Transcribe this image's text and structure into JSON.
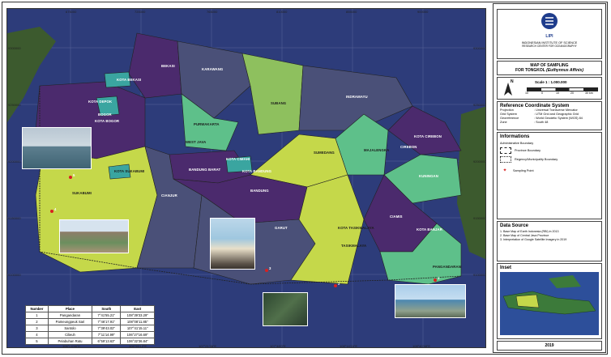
{
  "map": {
    "top_ticks": [
      "675000",
      "720000",
      "765000",
      "810000",
      "855000",
      "900000"
    ],
    "bottom_ticks": [
      "106°24'46\"E",
      "106°55'12\"E",
      "107°21'36\"E",
      "107°48'0\"E",
      "108°14'24\"E",
      "108°40'48\"E"
    ],
    "left_ticks": [
      "9300000",
      "9250000",
      "9200000",
      "9150000",
      "9100000"
    ],
    "right_ticks": [
      "9300000",
      "9250000",
      "9200000",
      "9150000",
      "9100000"
    ],
    "regions": [
      "BEKASI",
      "KARAWANG",
      "KOTA BEKASI",
      "KOTA DEPOK",
      "BOGOR",
      "KOTA BOGOR",
      "SUBANG",
      "PURWAKARTA",
      "INDRAMAYU",
      "WEST JAVA",
      "BANDUNG BARAT",
      "KOTA CIMAHI",
      "KOTA BANDUNG",
      "SUMEDANG",
      "MAJALENGKA",
      "CIREBON",
      "KOTA CIREBON",
      "KUNINGAN",
      "KOTA SUKABUMI",
      "SUKABUMI",
      "CIANJUR",
      "BANDUNG",
      "GARUT",
      "KOTA TASIKMALAYA",
      "TASIKMALAYA",
      "CIAMIS",
      "KOTA BANJAR",
      "PANGANDARAN"
    ],
    "point_numbers": [
      "1",
      "2",
      "3",
      "4",
      "5"
    ],
    "colors": {
      "sea": "#2d3c7a",
      "purple": "#4b2a6d",
      "slate": "#4a5078",
      "green": "#5ec08a",
      "lime": "#c5d84a",
      "olive": "#8ec05e",
      "teal": "#3aa5a0",
      "marker": "#d92020"
    }
  },
  "places_table": {
    "headers": [
      "Number",
      "Place",
      "South",
      "East"
    ],
    "rows": [
      [
        "1",
        "Pangandaran",
        "7°41'55.21\"",
        "108°39'33.29\""
      ],
      [
        "2",
        "Pameungpeuk Sari",
        "7°46'17.91\"",
        "108°08'11.85\""
      ],
      [
        "3",
        "Santolo",
        "7°39'43.02\"",
        "107°41'15.11\""
      ],
      [
        "4",
        "Cilieuh",
        "7°11'14.99\"",
        "106°27'16.69\""
      ],
      [
        "5",
        "Pelabuhan Ratu",
        "6°59'13.63\"",
        "106°32'36.84\""
      ]
    ]
  },
  "legend": {
    "org_name": "INDONESIAN INSTITUTE OF SCIENCE",
    "org_sub": "RESEARCH CENTER FOR OCEANOGRAPHY",
    "logo_text": "LIPI",
    "title_line1": "MAP OF SAMPLING",
    "title_line2": "FOR TONGKOL",
    "title_species": "(Euthynnus Affinis)",
    "north": "N",
    "scale_label": "Scale 1 : 1.000.000",
    "scale_ticks": [
      "10",
      "0",
      "10",
      "20",
      "30 km"
    ],
    "ref_title": "Reference Coordinate System",
    "ref_rows": [
      [
        "Projection",
        ": Universal Transverse Mercator"
      ],
      [
        "Grid System",
        ": UTM Grid and Geographic Grid"
      ],
      [
        "Georeference",
        ": World Geodetic System (WGS) 84"
      ],
      [
        "Zone",
        ": South 48"
      ]
    ],
    "info_title": "Informations",
    "admin_boundary": "Administrative Boundary",
    "province_boundary": "Province Boundary",
    "regency_boundary": "Regency/Municipality Boundary",
    "sampling_point": "Sampling Point",
    "source_title": "Data Source",
    "source_items": [
      "1. Base Map of Earth Indonesia (RBI) in 2013",
      "2. Base Map of Central Java Province",
      "3. Interpretation of Google Satellite Imagery in 2019"
    ],
    "inset_title": "Inset",
    "year": "2019"
  }
}
